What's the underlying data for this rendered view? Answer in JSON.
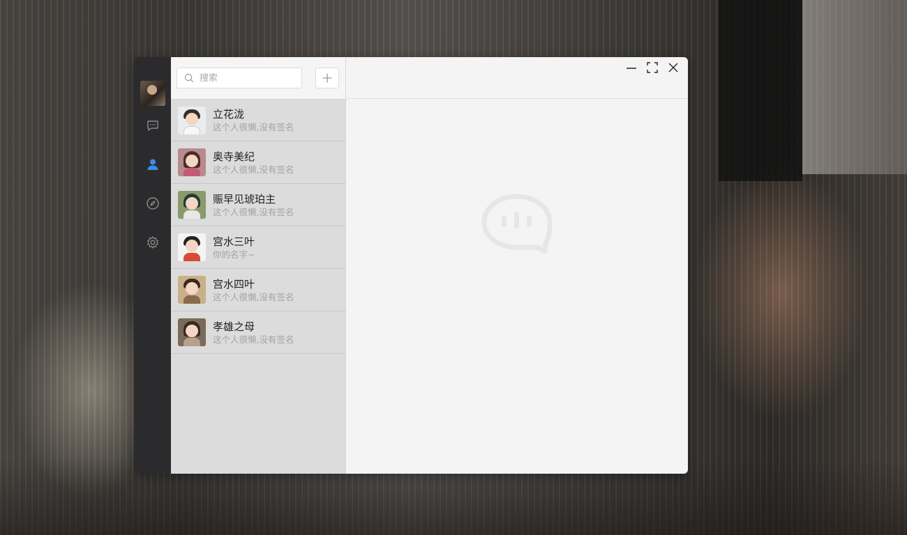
{
  "search": {
    "placeholder": "搜索"
  },
  "sidebar": {
    "items": [
      {
        "name": "chat",
        "icon": "chat-bubble-icon",
        "active": false
      },
      {
        "name": "contacts",
        "icon": "user-icon",
        "active": true
      },
      {
        "name": "discover",
        "icon": "compass-icon",
        "active": false
      },
      {
        "name": "settings",
        "icon": "gear-icon",
        "active": false
      }
    ],
    "active_color": "#3a8ee6",
    "icon_color": "#8c8c8c"
  },
  "contacts": [
    {
      "name": "立花泷",
      "signature": "这个人很懒,没有签名"
    },
    {
      "name": "奥寺美纪",
      "signature": "这个人很懒,没有签名"
    },
    {
      "name": "赈早见琥珀主",
      "signature": "这个人很懒,没有签名"
    },
    {
      "name": "宫水三叶",
      "signature": "你的名字~"
    },
    {
      "name": "宫水四叶",
      "signature": "这个人很懒,没有签名"
    },
    {
      "name": "孝雄之母",
      "signature": "这个人很懒,没有签名"
    }
  ],
  "window_controls": [
    "minimize-icon",
    "maximize-icon",
    "close-icon"
  ],
  "empty_state": {
    "icon": "chat-logo-icon"
  }
}
